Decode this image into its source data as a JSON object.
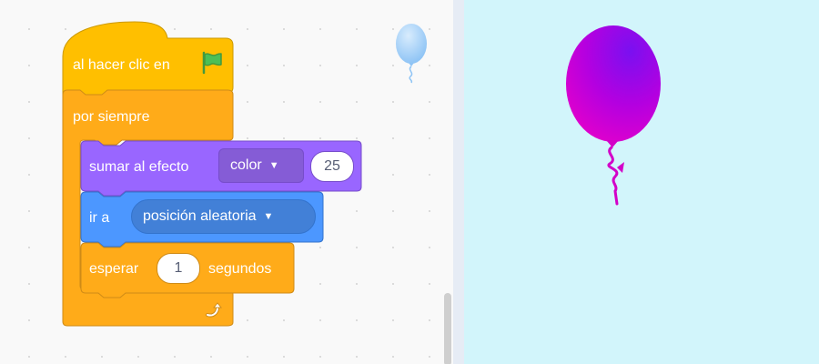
{
  "blocks": {
    "hat": {
      "label": "al hacer clic en",
      "flag_icon": "green-flag-icon"
    },
    "forever": {
      "label": "por siempre",
      "loop_icon": "loop-arrow-icon"
    },
    "change_effect": {
      "label": "sumar al efecto",
      "effect": "color",
      "amount": "25"
    },
    "goto": {
      "label": "ir a",
      "target": "posición aleatoria"
    },
    "wait": {
      "prefix": "esperar",
      "seconds": "1",
      "suffix": "segundos"
    }
  },
  "sprite_thumbnail": {
    "icon": "balloon-icon",
    "color": "#a8d4f8"
  },
  "stage_sprite": {
    "icon": "balloon-icon",
    "color": "#c000e6"
  },
  "colors": {
    "events": "#ffbf00",
    "control": "#ffab19",
    "looks": "#9966ff",
    "motion": "#4c97ff",
    "stage_bg": "#d2f5fb"
  }
}
